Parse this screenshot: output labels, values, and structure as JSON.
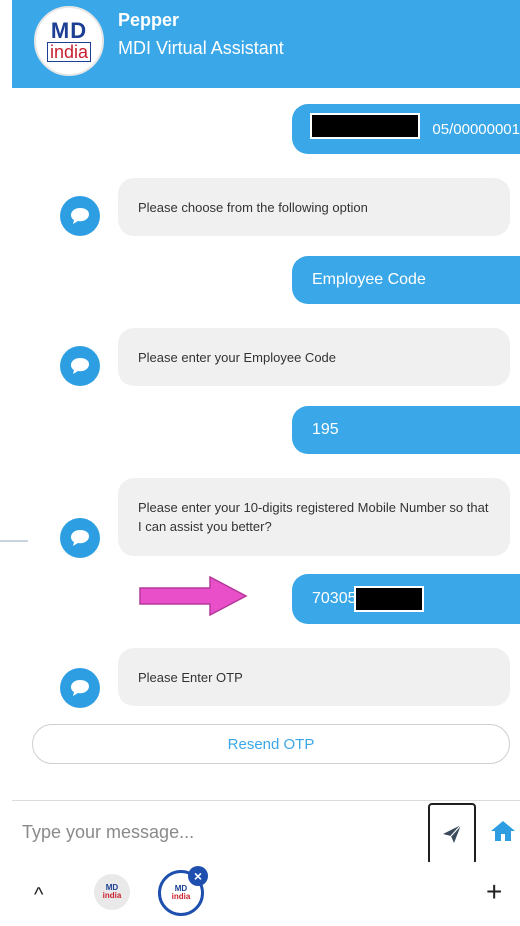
{
  "header": {
    "logo_top": "MD",
    "logo_bottom": "india",
    "bot_name": "Pepper",
    "subtitle": "MDI Virtual Assistant"
  },
  "messages": [
    {
      "from": "user",
      "text": "05/00000001",
      "redacted": true
    },
    {
      "from": "bot",
      "text": "Please choose from the following option"
    },
    {
      "from": "user",
      "text": "Employee Code"
    },
    {
      "from": "bot",
      "text": "Please enter your Employee Code"
    },
    {
      "from": "user",
      "text": "195"
    },
    {
      "from": "bot",
      "text": "Please enter your 10-digits registered Mobile Number so that I can assist you better?"
    },
    {
      "from": "user",
      "text": "70305",
      "redacted": true
    },
    {
      "from": "bot",
      "text": "Please Enter OTP"
    }
  ],
  "resend_label": "Resend OTP",
  "input": {
    "placeholder": "Type your message...",
    "value": ""
  },
  "icons": {
    "send": "send-icon",
    "home": "home-icon",
    "bot_avatar": "chat-bubble-icon",
    "annotation": "arrow-right-icon"
  },
  "nav": {
    "up": "^",
    "plus": "+",
    "close": "×",
    "tab_logo_top": "MD",
    "tab_logo_bottom": "india"
  },
  "colors": {
    "accent": "#3aa7e8",
    "bot_bubble": "#f0f0f0",
    "annotation_arrow": "#e84fc8"
  }
}
